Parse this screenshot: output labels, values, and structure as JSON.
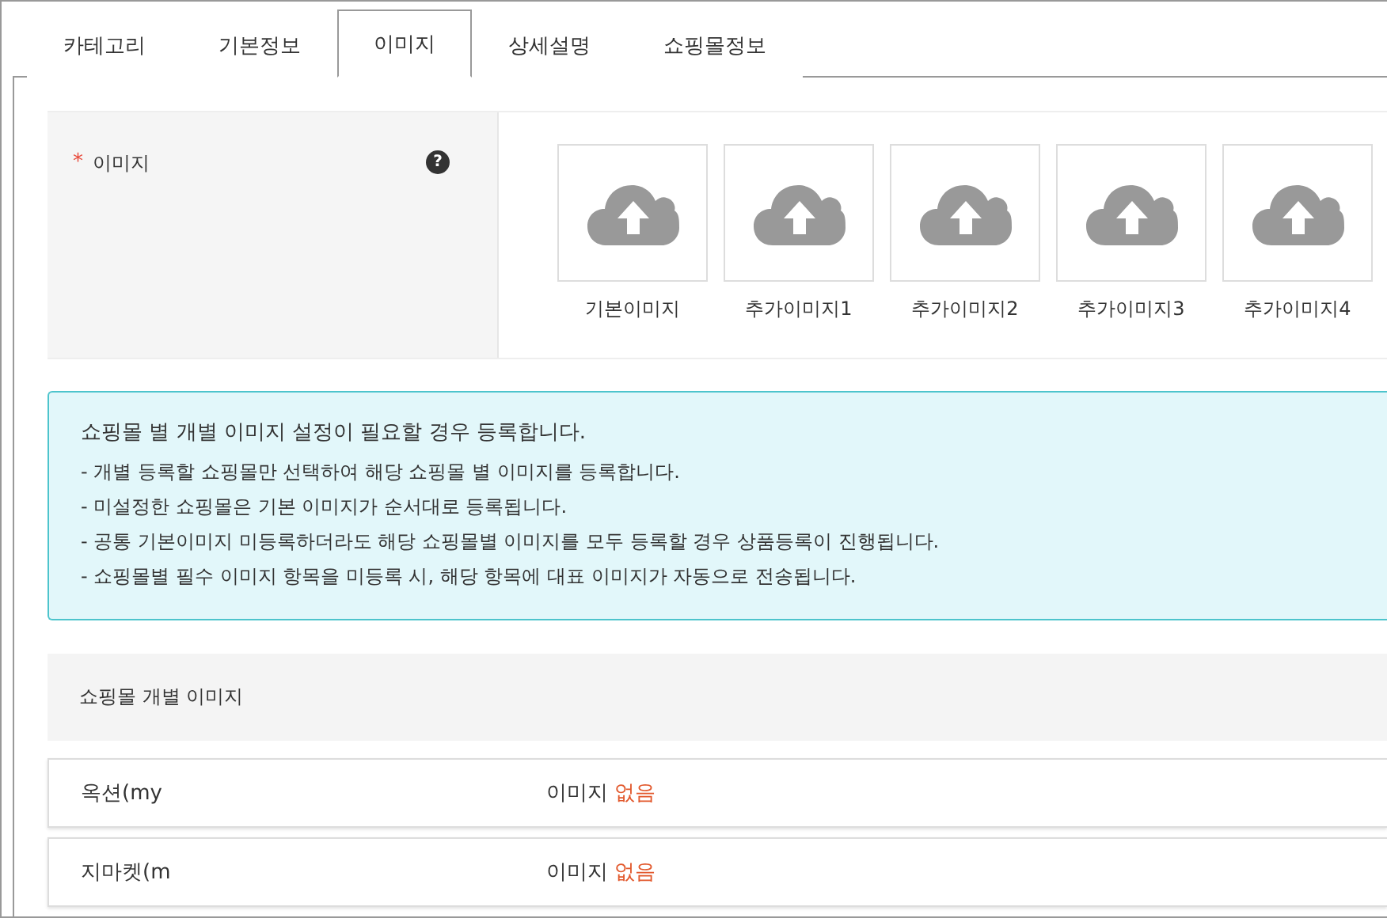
{
  "tabs": [
    {
      "label": "카테고리",
      "selected": false
    },
    {
      "label": "기본정보",
      "selected": false
    },
    {
      "label": "이미지",
      "selected": true
    },
    {
      "label": "상세설명",
      "selected": false
    },
    {
      "label": "쇼핑몰정보",
      "selected": false
    }
  ],
  "image_field": {
    "required_mark": "*",
    "label": "이미지",
    "help": "?",
    "slots": [
      {
        "label": "기본이미지"
      },
      {
        "label": "추가이미지1"
      },
      {
        "label": "추가이미지2"
      },
      {
        "label": "추가이미지3"
      },
      {
        "label": "추가이미지4"
      }
    ]
  },
  "notice": {
    "title": "쇼핑몰 별 개별 이미지 설정이 필요할 경우 등록합니다.",
    "lines": [
      "- 개별 등록할 쇼핑몰만 선택하여 해당 쇼핑몰 별 이미지를 등록합니다.",
      "- 미설정한 쇼핑몰은 기본 이미지가 순서대로 등록됩니다.",
      "- 공통 기본이미지 미등록하더라도 해당 쇼핑몰별 이미지를 모두 등록할 경우 상품등록이 진행됩니다.",
      "- 쇼핑몰별 필수 이미지 항목을 미등록 시, 해당 항목에 대표 이미지가 자동으로 전송됩니다."
    ]
  },
  "section": {
    "title": "쇼핑몰 개별 이미지",
    "rows": [
      {
        "name": "옥션(my",
        "status_label": "이미지",
        "status_value": "없음"
      },
      {
        "name": "지마켓(m",
        "status_label": "이미지",
        "status_value": "없음"
      }
    ]
  }
}
